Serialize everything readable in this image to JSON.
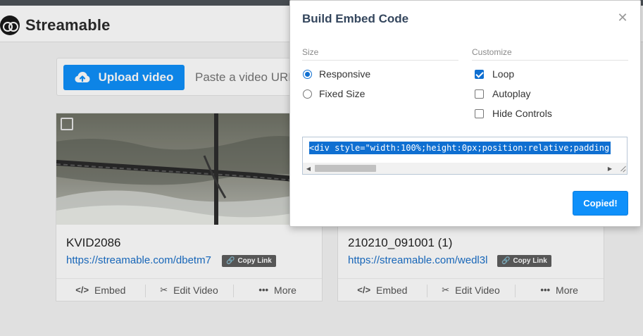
{
  "app": {
    "name": "Streamable"
  },
  "upload": {
    "button_label": "Upload video",
    "paste_placeholder": "Paste a video URL"
  },
  "cards": [
    {
      "title": "KVID2086",
      "link": "https://streamable.com/dbetm7",
      "copy_label": "Copy Link",
      "actions": {
        "embed": "Embed",
        "edit": "Edit Video",
        "more": "More"
      }
    },
    {
      "title": "210210_091001 (1)",
      "link": "https://streamable.com/wedl3l",
      "copy_label": "Copy Link",
      "actions": {
        "embed": "Embed",
        "edit": "Edit Video",
        "more": "More"
      }
    }
  ],
  "modal": {
    "title": "Build Embed Code",
    "close_icon": "close-icon",
    "size": {
      "label": "Size",
      "options": [
        {
          "label": "Responsive",
          "selected": true
        },
        {
          "label": "Fixed Size",
          "selected": false
        }
      ]
    },
    "customize": {
      "label": "Customize",
      "options": [
        {
          "label": "Loop",
          "checked": true
        },
        {
          "label": "Autoplay",
          "checked": false
        },
        {
          "label": "Hide Controls",
          "checked": false
        }
      ]
    },
    "code": "<div style=\"width:100%;height:0px;position:relative;padding",
    "copy_button": "Copied!"
  },
  "colors": {
    "accent": "#0f90fa",
    "selection": "#0f6fd1",
    "modal_title": "#34465d",
    "link": "#1a6fc8"
  }
}
